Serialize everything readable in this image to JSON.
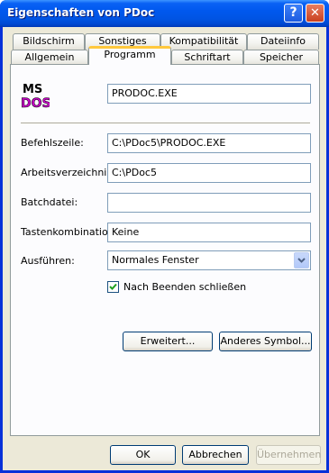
{
  "window": {
    "title": "Eigenschaften von PDoc"
  },
  "titlebar": {
    "help_glyph": "?",
    "close_glyph": "✕"
  },
  "tabs_back": [
    "Bildschirm",
    "Sonstiges",
    "Kompatibilität",
    "Dateiinfo"
  ],
  "tabs_front": [
    "Allgemein",
    "Programm",
    "Schriftart",
    "Speicher"
  ],
  "icon": {
    "top": "MS",
    "bottom": "DOS"
  },
  "program": {
    "name": "PRODOC.EXE",
    "befehlszeile_label": "Befehlszeile:",
    "befehlszeile_value": "C:\\PDoc5\\PRODOC.EXE",
    "arbeitsverzeichnis_label": "Arbeitsverzeichnis:",
    "arbeitsverzeichnis_value": "C:\\PDoc5",
    "batchdatei_label": "Batchdatei:",
    "batchdatei_value": "",
    "tastenkombination_label": "Tastenkombination:",
    "tastenkombination_value": "Keine",
    "ausfuehren_label": "Ausführen:",
    "ausfuehren_value": "Normales Fenster",
    "close_on_exit_label": "Nach Beenden schließen",
    "close_on_exit_checked": true
  },
  "buttons": {
    "erweitert": "Erweitert...",
    "anderes_symbol": "Anderes Symbol...",
    "ok": "OK",
    "abbrechen": "Abbrechen",
    "uebernehmen": "Übernehmen"
  }
}
